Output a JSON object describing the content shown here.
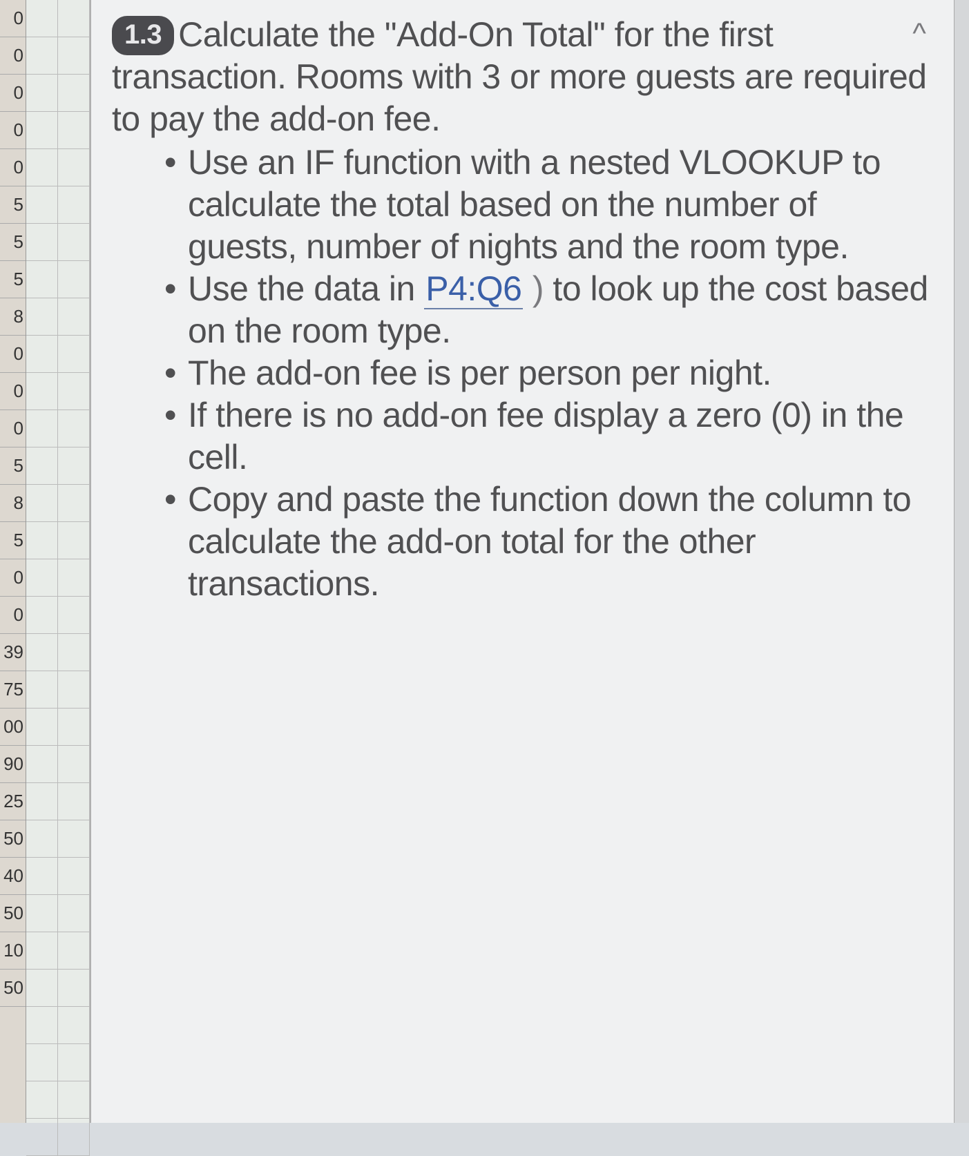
{
  "rowHeaders": [
    "0",
    "0",
    "0",
    "0",
    "0",
    "5",
    "5",
    "5",
    "8",
    "0",
    "0",
    "0",
    "5",
    "8",
    "5",
    "0",
    "0",
    "39",
    "75",
    "00",
    "90",
    "25",
    "50",
    "40",
    "50",
    "10",
    "50"
  ],
  "task": {
    "badge": "1.3",
    "intro": "Calculate the \"Add-On Total\" for the first transaction. Rooms with 3 or more guests are required to pay the add-on fee.",
    "bullets": [
      {
        "pre": "Use an IF function with a nested VLOOKUP to calculate the total based on the number of guests, number of nights and the room type."
      },
      {
        "pre": "Use the data in ",
        "ref": "P4:Q6",
        "post": " to look up the cost based on the room type."
      },
      {
        "pre": "The add-on fee is per person per night."
      },
      {
        "pre": "If there is no add-on fee display a zero (0) in the cell."
      },
      {
        "pre": "Copy and paste the function down the column to calculate the add-on total for the other transactions."
      }
    ],
    "caret": "^"
  }
}
